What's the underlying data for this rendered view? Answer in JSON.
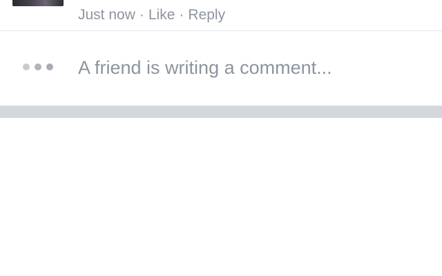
{
  "comment": {
    "timestamp": "Just now",
    "separator": "·",
    "like_label": "Like",
    "reply_label": "Reply"
  },
  "typing_indicator": {
    "text": "A friend is writing a comment..."
  },
  "colors": {
    "meta_text": "#8d949e",
    "divider": "#e4e6ea",
    "section_band": "#d4d7dc",
    "dots": "#bec3c9"
  }
}
